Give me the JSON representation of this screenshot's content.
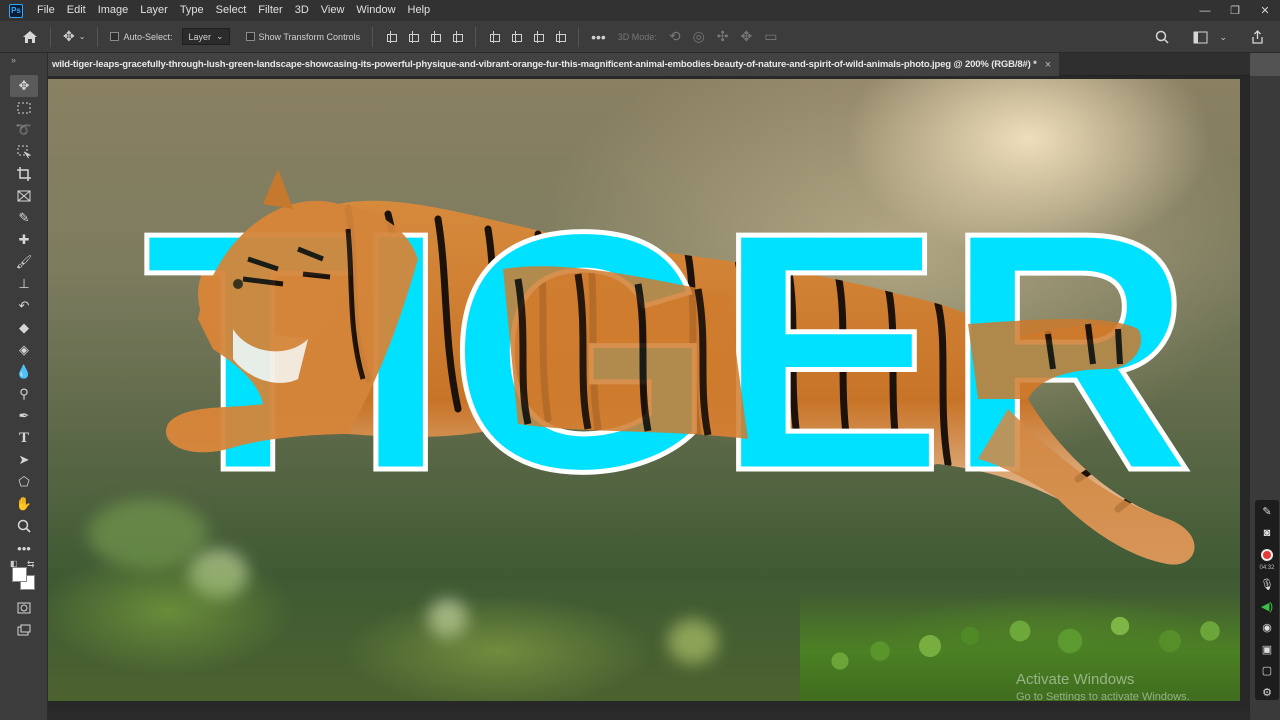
{
  "app": {
    "logo": "Ps",
    "menu": [
      "File",
      "Edit",
      "Image",
      "Layer",
      "Type",
      "Select",
      "Filter",
      "3D",
      "View",
      "Window",
      "Help"
    ],
    "window_controls": [
      "—",
      "❐",
      "✕"
    ]
  },
  "options_bar": {
    "auto_select_label": "Auto-Select:",
    "auto_select_value": "Layer",
    "show_transform_label": "Show Transform Controls",
    "mode_3d_label": "3D Mode:"
  },
  "document": {
    "tab_title": "wild-tiger-leaps-gracefully-through-lush-green-landscape-showcasing-its-powerful-physique-and-vibrant-orange-fur-this-magnificent-animal-embodies-beauty-of-nature-and-spirit-of-wild-animals-photo.jpeg @ 200% (RGB/8#) *",
    "close": "×"
  },
  "canvas": {
    "headline": "TIGER",
    "text_fill": "#00e1ff",
    "text_stroke": "#ffffff"
  },
  "toolbar": {
    "tools": [
      "move-tool",
      "marquee-tool",
      "lasso-tool",
      "object-select-tool",
      "crop-tool",
      "frame-tool",
      "eyedropper-tool",
      "healing-brush-tool",
      "brush-tool",
      "clone-stamp-tool",
      "history-brush-tool",
      "eraser-tool",
      "paint-bucket-tool",
      "blur-tool",
      "dodge-tool",
      "pen-tool",
      "type-tool",
      "path-select-tool",
      "ellipse-tool",
      "hand-tool",
      "zoom-tool",
      "more-tools"
    ],
    "foreground_color": "#ffffff",
    "background_color": "#ffffff"
  },
  "recorder": {
    "time": "04:32"
  },
  "watermark": {
    "title": "Activate Windows",
    "subtitle": "Go to Settings to activate Windows."
  }
}
